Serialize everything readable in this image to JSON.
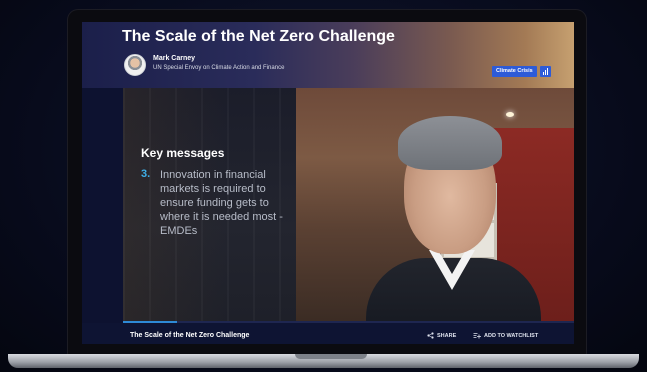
{
  "header": {
    "title": "The Scale of the Net Zero Challenge",
    "speaker_name": "Mark Carney",
    "speaker_role": "UN Special Envoy on Climate Action and Finance",
    "tag_label": "Climate Crisis"
  },
  "slide": {
    "heading": "Key messages",
    "number": "3.",
    "text": "Innovation in financial markets is required to ensure funding gets to where it is needed most - EMDEs"
  },
  "player": {
    "progress": 0.12,
    "bottom_title": "The Scale of the Net Zero Challenge",
    "share_label": "SHARE",
    "watchlist_label": "ADD TO WATCHLIST"
  },
  "colors": {
    "accent": "#2d5bd8",
    "progress": "#2e8ad6",
    "slide_number": "#3fb0e8",
    "background": "#0d1230"
  },
  "icons": [
    "share-icon",
    "watchlist-icon",
    "chart-icon"
  ]
}
